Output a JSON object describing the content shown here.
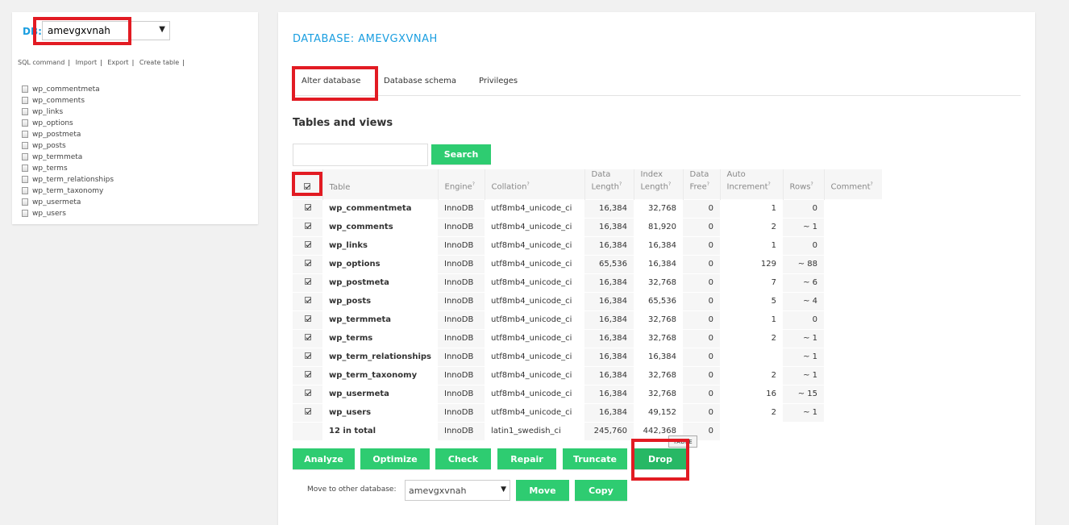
{
  "sidebar": {
    "db_label": "DB:",
    "db_value": "amevgxvnah",
    "links": [
      "SQL command",
      "Import",
      "Export",
      "Create table"
    ],
    "tables": [
      "wp_commentmeta",
      "wp_comments",
      "wp_links",
      "wp_options",
      "wp_postmeta",
      "wp_posts",
      "wp_termmeta",
      "wp_terms",
      "wp_term_relationships",
      "wp_term_taxonomy",
      "wp_usermeta",
      "wp_users"
    ]
  },
  "main": {
    "title": "DATABASE: AMEVGXVNAH",
    "tabs": [
      "Alter database",
      "Database schema",
      "Privileges"
    ],
    "section_title": "Tables and views",
    "search_button": "Search",
    "columns": {
      "table": "Table",
      "engine": "Engine",
      "collation": "Collation",
      "data_length_1": "Data",
      "data_length_2": "Length",
      "index_length_1": "Index",
      "index_length_2": "Length",
      "data_free_1": "Data",
      "data_free_2": "Free",
      "auto_inc_1": "Auto",
      "auto_inc_2": "Increment",
      "rows": "Rows",
      "comment": "Comment",
      "help_mark": "?"
    },
    "rows": [
      {
        "name": "wp_commentmeta",
        "engine": "InnoDB",
        "collation": "utf8mb4_unicode_ci",
        "data_length": "16,384",
        "index_length": "32,768",
        "data_free": "0",
        "auto_increment": "1",
        "rows": "0"
      },
      {
        "name": "wp_comments",
        "engine": "InnoDB",
        "collation": "utf8mb4_unicode_ci",
        "data_length": "16,384",
        "index_length": "81,920",
        "data_free": "0",
        "auto_increment": "2",
        "rows": "~ 1"
      },
      {
        "name": "wp_links",
        "engine": "InnoDB",
        "collation": "utf8mb4_unicode_ci",
        "data_length": "16,384",
        "index_length": "16,384",
        "data_free": "0",
        "auto_increment": "1",
        "rows": "0"
      },
      {
        "name": "wp_options",
        "engine": "InnoDB",
        "collation": "utf8mb4_unicode_ci",
        "data_length": "65,536",
        "index_length": "16,384",
        "data_free": "0",
        "auto_increment": "129",
        "rows": "~ 88"
      },
      {
        "name": "wp_postmeta",
        "engine": "InnoDB",
        "collation": "utf8mb4_unicode_ci",
        "data_length": "16,384",
        "index_length": "32,768",
        "data_free": "0",
        "auto_increment": "7",
        "rows": "~ 6"
      },
      {
        "name": "wp_posts",
        "engine": "InnoDB",
        "collation": "utf8mb4_unicode_ci",
        "data_length": "16,384",
        "index_length": "65,536",
        "data_free": "0",
        "auto_increment": "5",
        "rows": "~ 4"
      },
      {
        "name": "wp_termmeta",
        "engine": "InnoDB",
        "collation": "utf8mb4_unicode_ci",
        "data_length": "16,384",
        "index_length": "32,768",
        "data_free": "0",
        "auto_increment": "1",
        "rows": "0"
      },
      {
        "name": "wp_terms",
        "engine": "InnoDB",
        "collation": "utf8mb4_unicode_ci",
        "data_length": "16,384",
        "index_length": "32,768",
        "data_free": "0",
        "auto_increment": "2",
        "rows": "~ 1"
      },
      {
        "name": "wp_term_relationships",
        "engine": "InnoDB",
        "collation": "utf8mb4_unicode_ci",
        "data_length": "16,384",
        "index_length": "16,384",
        "data_free": "0",
        "auto_increment": "",
        "rows": "~ 1"
      },
      {
        "name": "wp_term_taxonomy",
        "engine": "InnoDB",
        "collation": "utf8mb4_unicode_ci",
        "data_length": "16,384",
        "index_length": "32,768",
        "data_free": "0",
        "auto_increment": "2",
        "rows": "~ 1"
      },
      {
        "name": "wp_usermeta",
        "engine": "InnoDB",
        "collation": "utf8mb4_unicode_ci",
        "data_length": "16,384",
        "index_length": "32,768",
        "data_free": "0",
        "auto_increment": "16",
        "rows": "~ 15"
      },
      {
        "name": "wp_users",
        "engine": "InnoDB",
        "collation": "utf8mb4_unicode_ci",
        "data_length": "16,384",
        "index_length": "49,152",
        "data_free": "0",
        "auto_increment": "2",
        "rows": "~ 1"
      }
    ],
    "total": {
      "name": "12 in total",
      "engine": "InnoDB",
      "collation": "latin1_swedish_ci",
      "data_length": "245,760",
      "index_length": "442,368",
      "data_free": "0"
    },
    "tooltip": "TABLE",
    "actions": [
      "Analyze",
      "Optimize",
      "Check",
      "Repair",
      "Truncate",
      "Drop"
    ],
    "move_label": "Move to other database:",
    "move_value": "amevgxvnah",
    "move_button": "Move",
    "copy_button": "Copy"
  },
  "colors": {
    "accent": "#1a9ee0",
    "button": "#2ecc71",
    "highlight": "#e21b23"
  }
}
